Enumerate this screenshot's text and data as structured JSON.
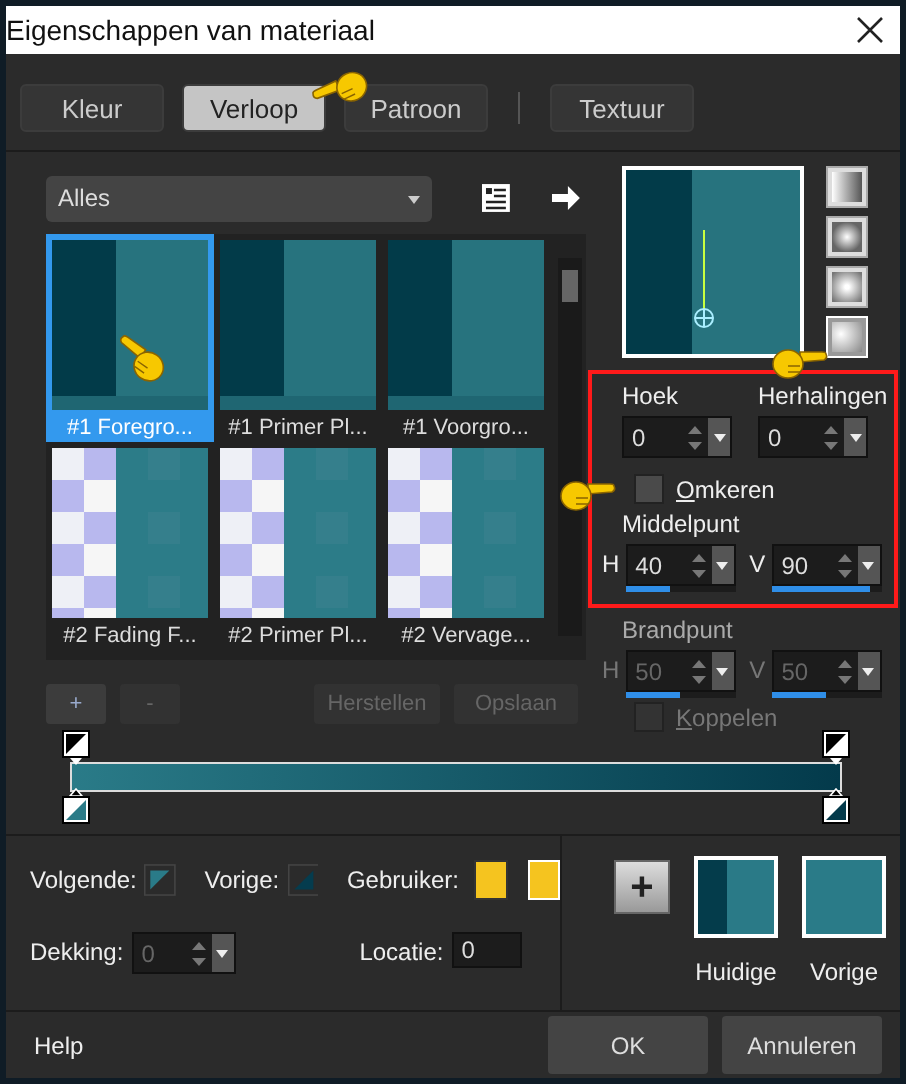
{
  "window": {
    "title": "Eigenschappen van materiaal"
  },
  "tabs": [
    {
      "label": "Kleur",
      "selected": false
    },
    {
      "label": "Verloop",
      "selected": true
    },
    {
      "label": "Patroon",
      "selected": false
    },
    {
      "label": "Textuur",
      "selected": false
    }
  ],
  "gallery": {
    "filter": "Alles",
    "items": [
      {
        "label": "#1 Foregro...",
        "kind": "two-tone",
        "selected": true
      },
      {
        "label": "#1 Primer Pl...",
        "kind": "two-tone",
        "selected": false
      },
      {
        "label": "#1 Voorgro...",
        "kind": "two-tone",
        "selected": false
      },
      {
        "label": "#2 Fading F...",
        "kind": "checker",
        "selected": false
      },
      {
        "label": "#2 Primer Pl...",
        "kind": "checker",
        "selected": false
      },
      {
        "label": "#2 Vervage...",
        "kind": "checker",
        "selected": false
      }
    ]
  },
  "styles": [
    {
      "kind": "linear",
      "selected": false
    },
    {
      "kind": "rectangular",
      "selected": false
    },
    {
      "kind": "radial",
      "selected": false
    },
    {
      "kind": "sunburst",
      "selected": true
    }
  ],
  "angle": {
    "label": "Hoek",
    "value": "0"
  },
  "repeats": {
    "label": "Herhalingen",
    "value": "0"
  },
  "reverse": {
    "label": "Omkeren",
    "checked": false
  },
  "center": {
    "label": "Middelpunt",
    "h": {
      "label": "H",
      "value": "40",
      "level": 0.4
    },
    "v": {
      "label": "V",
      "value": "90",
      "level": 0.9
    }
  },
  "focus": {
    "label": "Brandpunt",
    "disabled": true,
    "h": {
      "label": "H",
      "value": "50",
      "level": 0.5
    },
    "v": {
      "label": "V",
      "value": "50",
      "level": 0.5
    },
    "link": {
      "label": "Koppelen",
      "checked": false
    }
  },
  "editor": {
    "buttons": [
      {
        "label": "+",
        "disabled": false
      },
      {
        "label": "-",
        "disabled": true
      },
      {
        "label": "Herstellen",
        "disabled": true
      },
      {
        "label": "Opslaan",
        "disabled": true
      }
    ]
  },
  "stop": {
    "next_label": "Volgende:",
    "prev_label": "Vorige:",
    "user_label": "Gebruiker:",
    "opacity": {
      "label": "Dekking:",
      "value": "0",
      "disabled": true
    },
    "location": {
      "label": "Locatie:",
      "value": "0"
    }
  },
  "add_button": "+",
  "swatches": [
    {
      "label": "Huidige",
      "kind": "gradient"
    },
    {
      "label": "Vorige",
      "kind": "solid"
    }
  ],
  "footer": {
    "help": "Help",
    "buttons": [
      "OK",
      "Annuleren"
    ]
  }
}
